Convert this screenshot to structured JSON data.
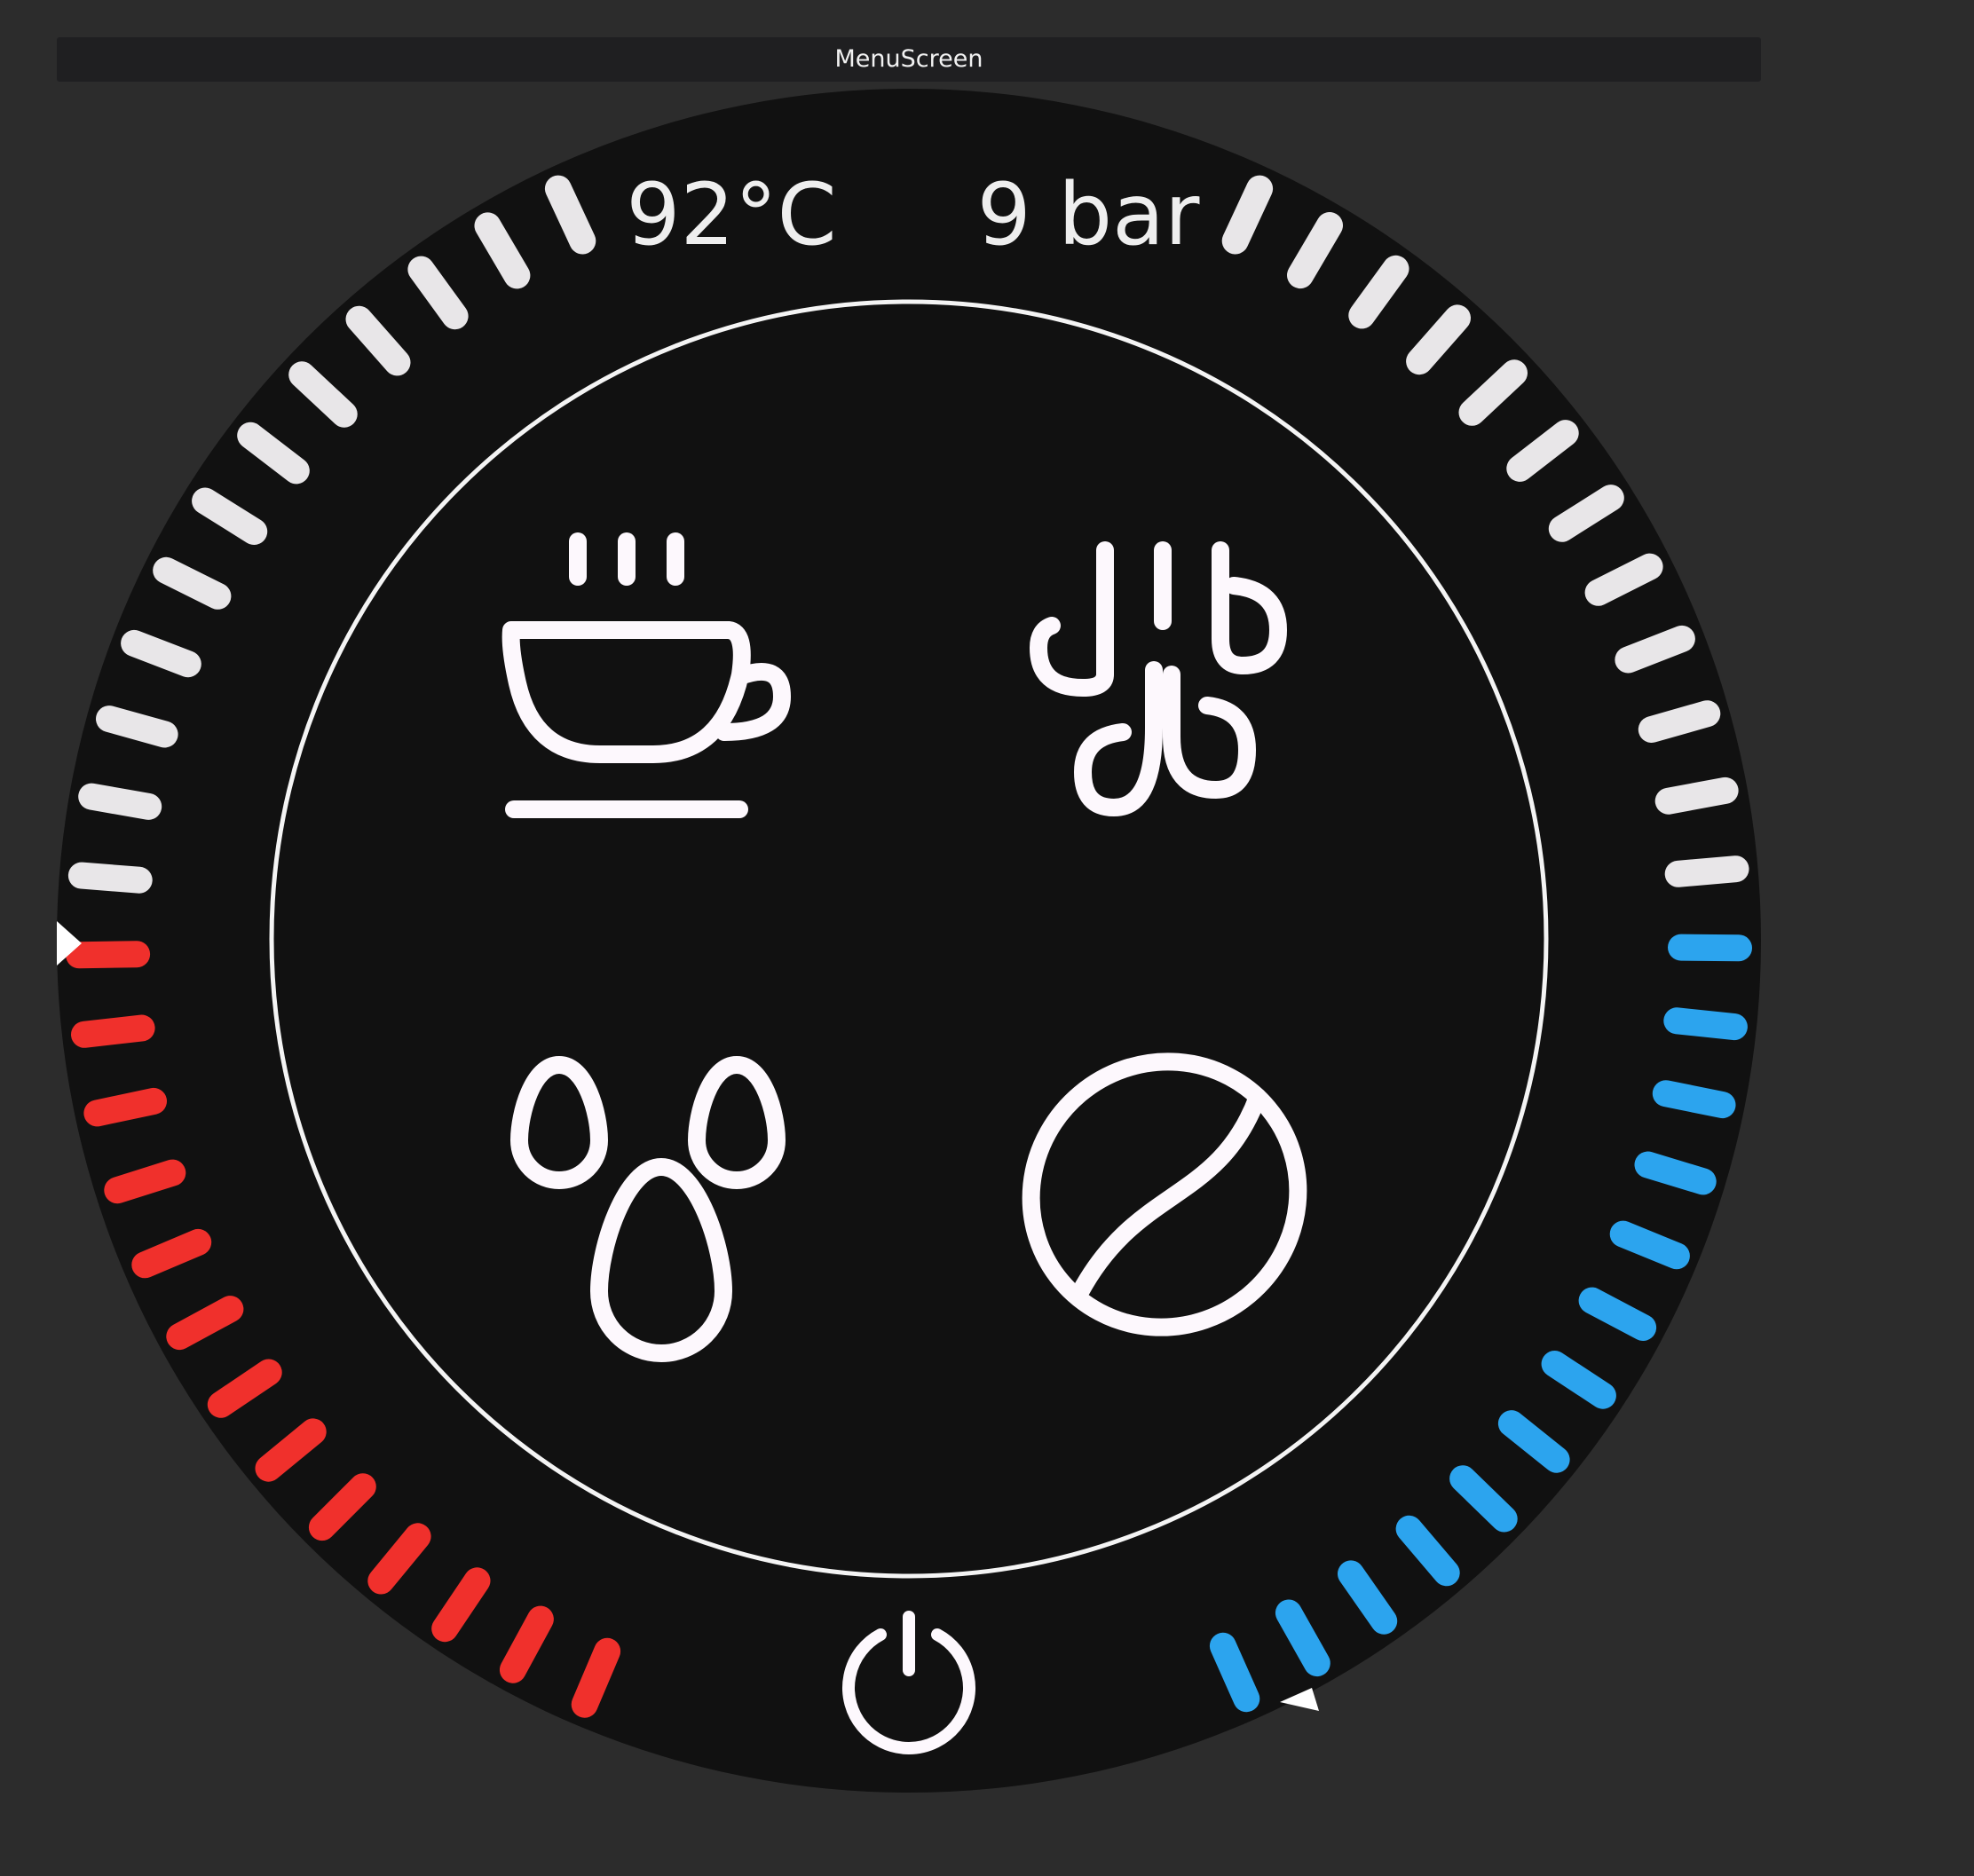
{
  "window": {
    "title": "MenuScreen"
  },
  "status": {
    "temperature": "92°C",
    "pressure": "9 bar"
  },
  "gauges": {
    "temperature": {
      "level": 0.5,
      "active_color": "#f0302c",
      "inactive_color": "#e8e6e8"
    },
    "pressure": {
      "level": 0.5,
      "active_color": "#2ca4ee",
      "inactive_color": "#e8e6e8"
    }
  },
  "menu": {
    "items": [
      {
        "id": "espresso",
        "icon": "coffee-cup-icon"
      },
      {
        "id": "steam",
        "icon": "steam-icon"
      },
      {
        "id": "hot-water",
        "icon": "water-drops-icon"
      },
      {
        "id": "grind",
        "icon": "coffee-bean-icon"
      }
    ],
    "power_icon": "power-icon"
  },
  "colors": {
    "background": "#2c2c2c",
    "dial": "#111111",
    "foreground": "#fdf8fd"
  }
}
